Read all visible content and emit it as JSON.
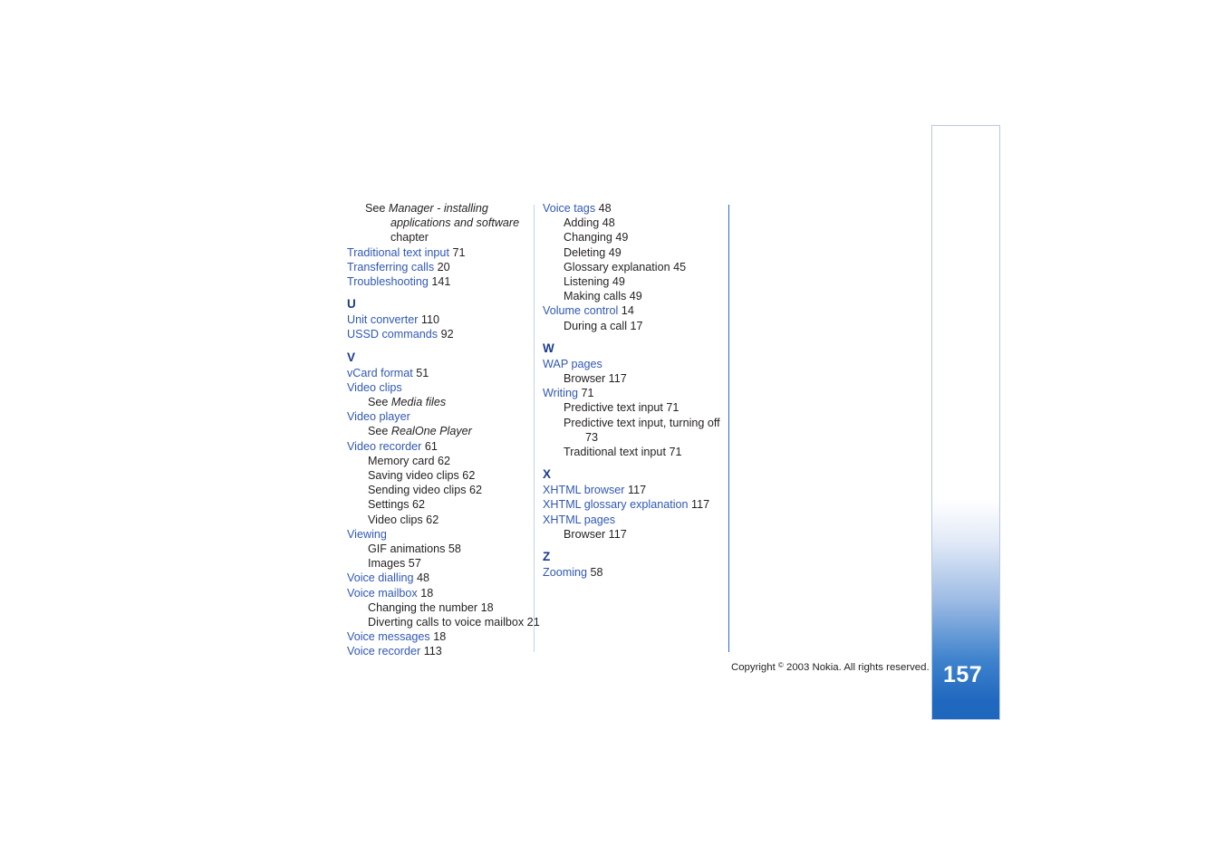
{
  "page": {
    "number": "157",
    "copyright_prefix": "Copyright ",
    "copyright_mark": "©",
    "copyright_suffix": " 2003 Nokia. All rights reserved."
  },
  "colors": {
    "entry_blue": "#3158b4",
    "letter_blue": "#1a3a8f",
    "body_black": "#231f20",
    "rule_light": "#c4d2e8",
    "rule_blue": "#2b6cc0",
    "pagebar_blue": "#2068bf"
  },
  "columns": [
    {
      "id": "column-1",
      "blocks": [
        {
          "type": "see-block",
          "line1_see": "See ",
          "line1_italic": "Manager - installing",
          "line2_italic": "applications and software",
          "line3": "chapter"
        },
        {
          "type": "entry",
          "label": "Traditional text input",
          "page": "71"
        },
        {
          "type": "entry",
          "label": "Transferring calls",
          "page": "20"
        },
        {
          "type": "entry",
          "label": "Troubleshooting",
          "page": "141"
        },
        {
          "type": "letter",
          "label": "U"
        },
        {
          "type": "entry",
          "label": "Unit converter",
          "page": "110"
        },
        {
          "type": "entry",
          "label": "USSD commands",
          "page": "92"
        },
        {
          "type": "letter",
          "label": "V"
        },
        {
          "type": "entry",
          "label": "vCard format",
          "page": "51"
        },
        {
          "type": "entry",
          "label": "Video clips",
          "page": ""
        },
        {
          "type": "see",
          "see": "See ",
          "target": "Media files"
        },
        {
          "type": "entry",
          "label": "Video player",
          "page": ""
        },
        {
          "type": "see",
          "see": "See ",
          "target": "RealOne Player"
        },
        {
          "type": "entry",
          "label": "Video recorder",
          "page": "61"
        },
        {
          "type": "sub",
          "label": "Memory card",
          "page": "62"
        },
        {
          "type": "sub",
          "label": "Saving video clips",
          "page": "62"
        },
        {
          "type": "sub",
          "label": "Sending video clips",
          "page": "62"
        },
        {
          "type": "sub",
          "label": "Settings",
          "page": "62"
        },
        {
          "type": "sub",
          "label": "Video clips",
          "page": "62"
        },
        {
          "type": "entry",
          "label": "Viewing",
          "page": ""
        },
        {
          "type": "sub",
          "label": "GIF animations",
          "page": "58"
        },
        {
          "type": "sub",
          "label": "Images",
          "page": "57"
        },
        {
          "type": "entry",
          "label": "Voice dialling",
          "page": "48"
        },
        {
          "type": "entry",
          "label": "Voice mailbox",
          "page": "18"
        },
        {
          "type": "sub",
          "label": "Changing the number",
          "page": "18"
        },
        {
          "type": "sub",
          "label": "Diverting calls to voice mailbox",
          "page": "21"
        },
        {
          "type": "entry",
          "label": "Voice messages",
          "page": "18"
        },
        {
          "type": "entry",
          "label": "Voice recorder",
          "page": "113"
        }
      ]
    },
    {
      "id": "column-2",
      "blocks": [
        {
          "type": "entry",
          "label": "Voice tags",
          "page": "48"
        },
        {
          "type": "sub",
          "label": "Adding",
          "page": "48"
        },
        {
          "type": "sub",
          "label": "Changing",
          "page": "49"
        },
        {
          "type": "sub",
          "label": "Deleting",
          "page": "49"
        },
        {
          "type": "sub",
          "label": "Glossary explanation",
          "page": "45"
        },
        {
          "type": "sub",
          "label": "Listening",
          "page": "49"
        },
        {
          "type": "sub",
          "label": "Making calls",
          "page": "49"
        },
        {
          "type": "entry",
          "label": "Volume control",
          "page": "14"
        },
        {
          "type": "sub",
          "label": "During a call",
          "page": "17"
        },
        {
          "type": "letter",
          "label": "W"
        },
        {
          "type": "entry",
          "label": "WAP pages",
          "page": ""
        },
        {
          "type": "sub",
          "label": "Browser",
          "page": "117"
        },
        {
          "type": "entry",
          "label": "Writing",
          "page": "71"
        },
        {
          "type": "sub",
          "label": "Predictive text input",
          "page": "71"
        },
        {
          "type": "sub-wrap",
          "label": "Predictive text input, turning off",
          "page": "73"
        },
        {
          "type": "sub",
          "label": "Traditional text input",
          "page": "71"
        },
        {
          "type": "letter",
          "label": "X"
        },
        {
          "type": "entry",
          "label": "XHTML browser",
          "page": "117"
        },
        {
          "type": "entry",
          "label": "XHTML glossary explanation",
          "page": "117"
        },
        {
          "type": "entry",
          "label": "XHTML pages",
          "page": ""
        },
        {
          "type": "sub",
          "label": "Browser",
          "page": "117"
        },
        {
          "type": "letter",
          "label": "Z"
        },
        {
          "type": "entry",
          "label": "Zooming",
          "page": "58"
        }
      ]
    }
  ]
}
